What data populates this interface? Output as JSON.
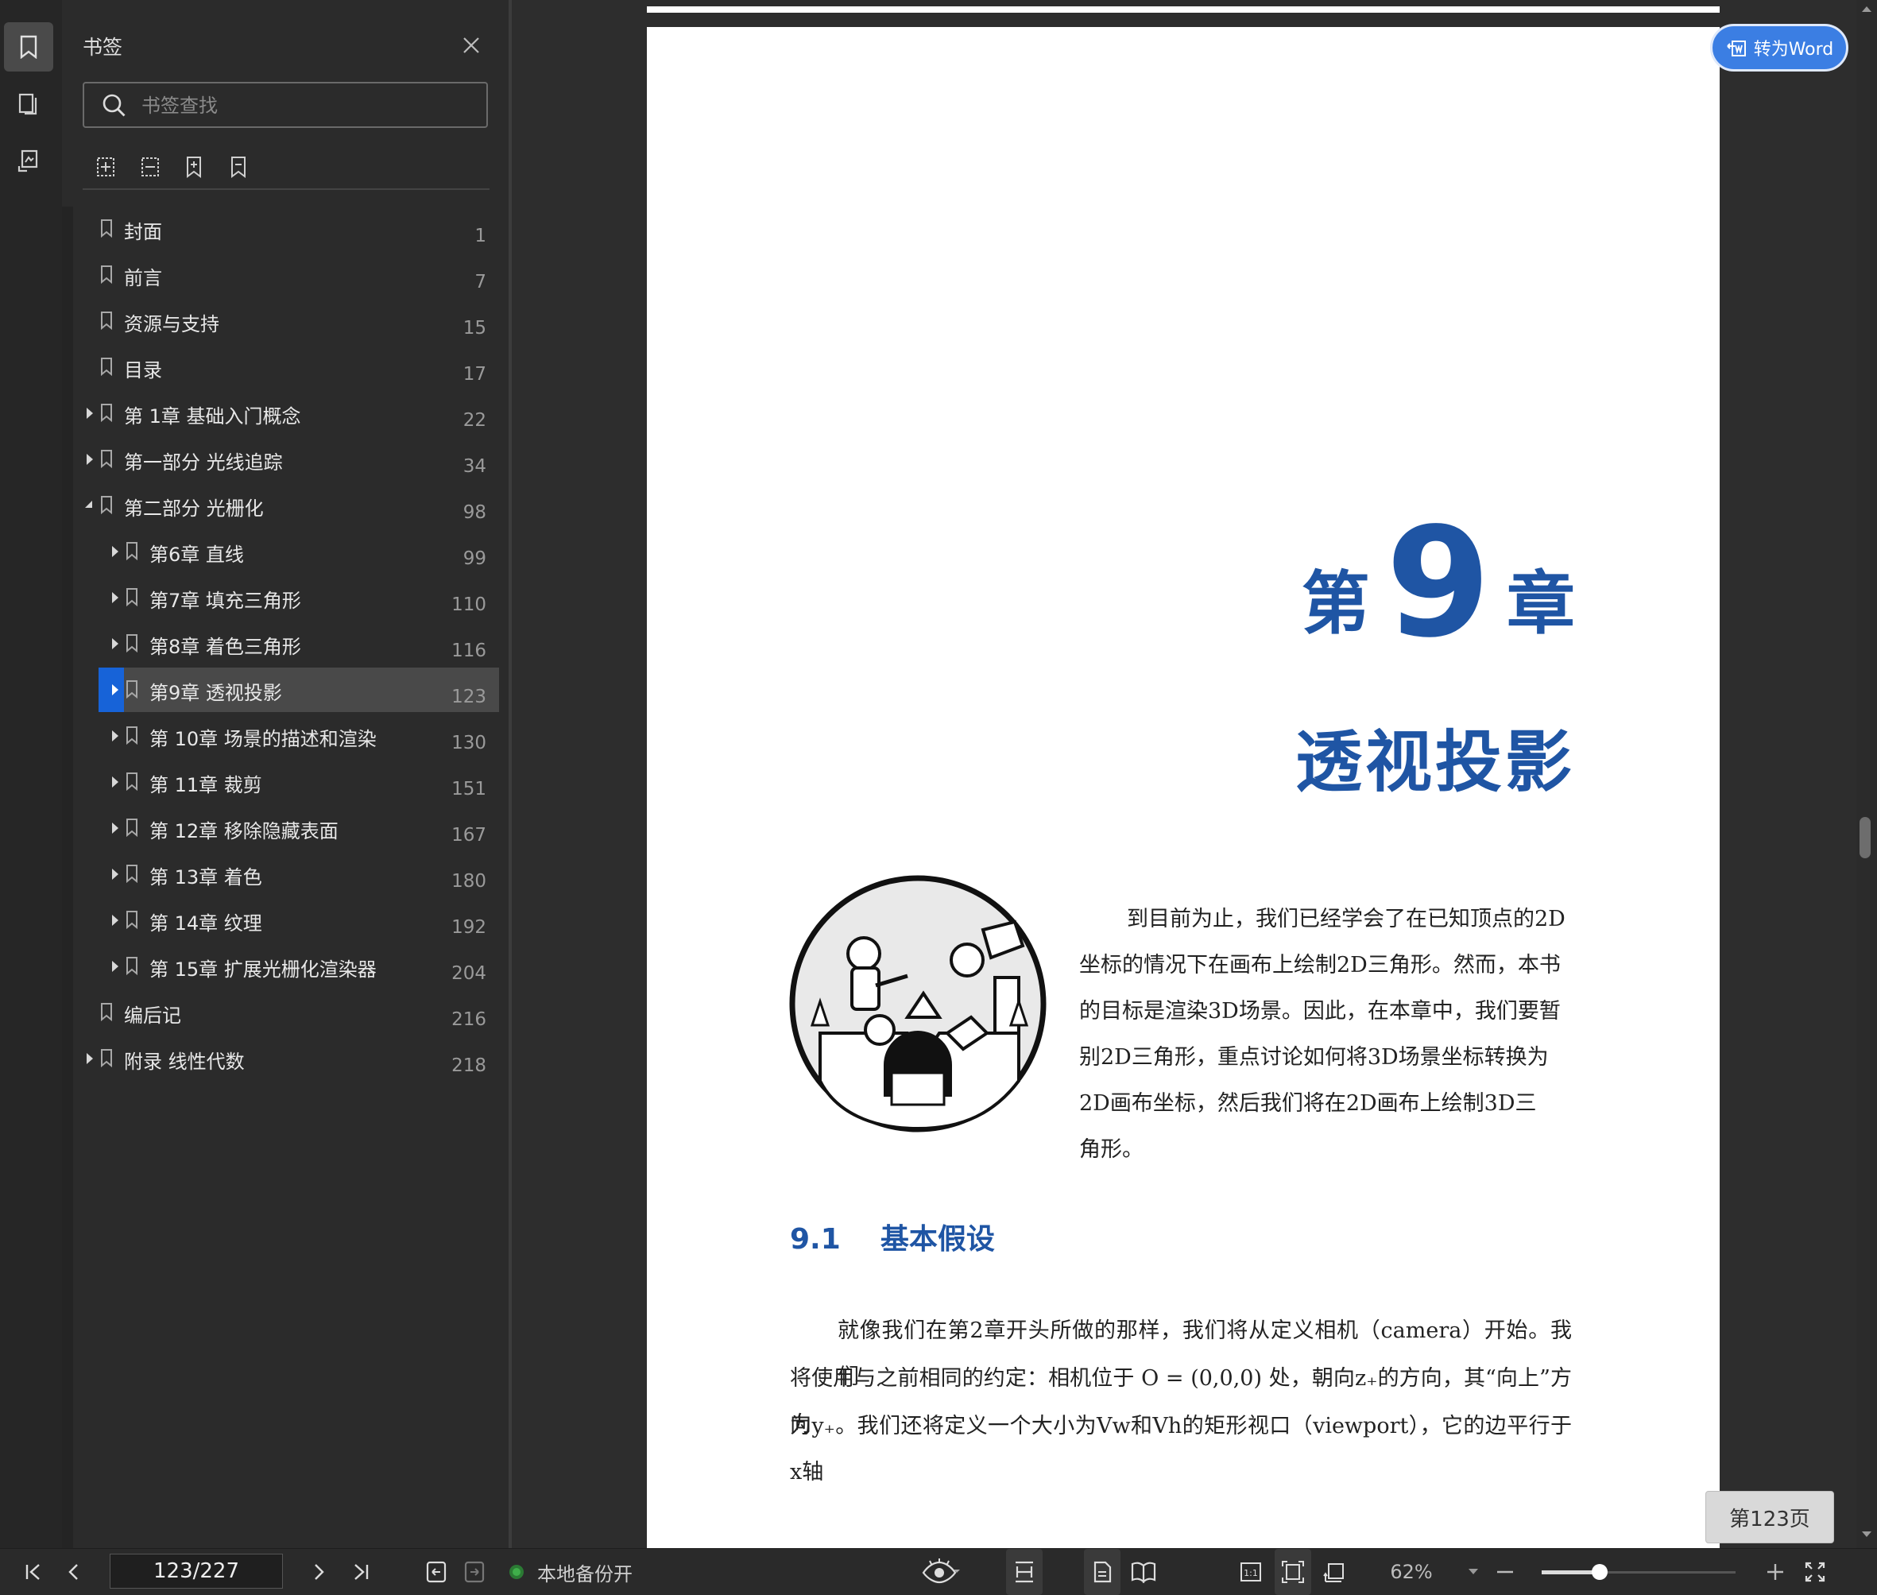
{
  "panel": {
    "title": "书签",
    "search_placeholder": "书签查找",
    "bookmarks": [
      {
        "label": "封面",
        "page": "1",
        "level": 0,
        "expandable": false,
        "expanded": false,
        "active": false
      },
      {
        "label": "前言",
        "page": "7",
        "level": 0,
        "expandable": false,
        "expanded": false,
        "active": false
      },
      {
        "label": "资源与支持",
        "page": "15",
        "level": 0,
        "expandable": false,
        "expanded": false,
        "active": false
      },
      {
        "label": "目录",
        "page": "17",
        "level": 0,
        "expandable": false,
        "expanded": false,
        "active": false
      },
      {
        "label": "第 1章 基础入门概念",
        "page": "22",
        "level": 0,
        "expandable": true,
        "expanded": false,
        "active": false
      },
      {
        "label": "第一部分 光线追踪",
        "page": "34",
        "level": 0,
        "expandable": true,
        "expanded": false,
        "active": false
      },
      {
        "label": "第二部分 光栅化",
        "page": "98",
        "level": 0,
        "expandable": true,
        "expanded": true,
        "active": false
      },
      {
        "label": "第6章 直线",
        "page": "99",
        "level": 1,
        "expandable": true,
        "expanded": false,
        "active": false
      },
      {
        "label": "第7章 填充三角形",
        "page": "110",
        "level": 1,
        "expandable": true,
        "expanded": false,
        "active": false
      },
      {
        "label": "第8章 着色三角形",
        "page": "116",
        "level": 1,
        "expandable": true,
        "expanded": false,
        "active": false
      },
      {
        "label": "第9章 透视投影",
        "page": "123",
        "level": 1,
        "expandable": true,
        "expanded": false,
        "active": true
      },
      {
        "label": "第 10章 场景的描述和渲染",
        "page": "130",
        "level": 1,
        "expandable": true,
        "expanded": false,
        "active": false
      },
      {
        "label": "第 11章 裁剪",
        "page": "151",
        "level": 1,
        "expandable": true,
        "expanded": false,
        "active": false
      },
      {
        "label": "第 12章 移除隐藏表面",
        "page": "167",
        "level": 1,
        "expandable": true,
        "expanded": false,
        "active": false
      },
      {
        "label": "第 13章 着色",
        "page": "180",
        "level": 1,
        "expandable": true,
        "expanded": false,
        "active": false
      },
      {
        "label": "第 14章 纹理",
        "page": "192",
        "level": 1,
        "expandable": true,
        "expanded": false,
        "active": false
      },
      {
        "label": "第 15章 扩展光栅化渲染器",
        "page": "204",
        "level": 1,
        "expandable": true,
        "expanded": false,
        "active": false
      },
      {
        "label": "编后记",
        "page": "216",
        "level": 0,
        "expandable": false,
        "expanded": false,
        "active": false
      },
      {
        "label": "附录 线性代数",
        "page": "218",
        "level": 0,
        "expandable": true,
        "expanded": false,
        "active": false
      }
    ]
  },
  "doc": {
    "to_word_label": "转为Word",
    "chapter_word_left": "第",
    "chapter_number": "9",
    "chapter_word_right": "章",
    "chapter_title": "透视投影",
    "intro_lines": [
      "到目前为止，我们已经学会了在已知顶点的2D",
      "坐标的情况下在画布上绘制2D三角形。然而，本书",
      "的目标是渲染3D场景。因此，在本章中，我们要暂",
      "别2D三角形，重点讨论如何将3D场景坐标转换为",
      "2D画布坐标，然后我们将在2D画布上绘制3D三",
      "角形。"
    ],
    "section_number": "9.1",
    "section_title": "基本假设",
    "body_lines": [
      "就像我们在第2章开头所做的那样，我们将从定义相机（camera）开始。我们",
      "将使用与之前相同的约定：相机位于 O = (0,0,0) 处，朝向z₊的方向，其“向上”方向",
      "为y₊。我们还将定义一个大小为Vw和Vh的矩形视口（viewport），它的边平行于x轴"
    ],
    "page_indicator": "第123页"
  },
  "bottom": {
    "page_field": "123/227",
    "backup_label": "本地备份开",
    "zoom": "62%",
    "zoom_level": 0.3
  },
  "colors": {
    "accent": "#1763d8",
    "heading_blue": "#1f55a4",
    "word_button": "#3b7ee3",
    "status_green": "#3fae4a"
  }
}
